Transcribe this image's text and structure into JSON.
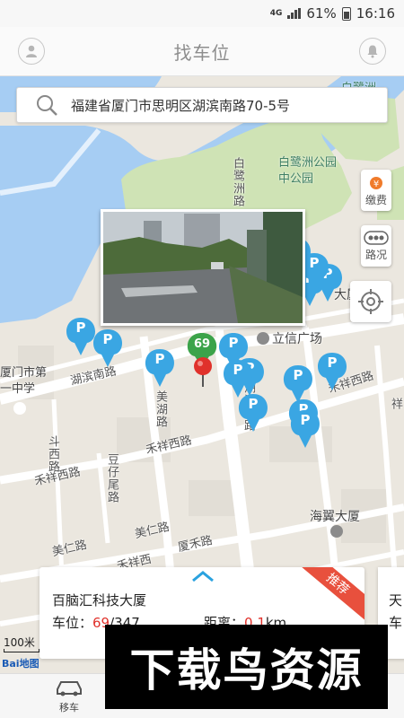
{
  "status_bar": {
    "network": "4G",
    "battery": "61%",
    "time": "16:16"
  },
  "header": {
    "title": "找车位",
    "left_icon": "user-icon",
    "right_icon": "bell-icon"
  },
  "search": {
    "address": "福建省厦门市思明区湖滨南路70-5号",
    "icon": "search-icon"
  },
  "side_buttons": [
    {
      "label": "缴费",
      "icon": "money-bag-icon"
    },
    {
      "label": "路况",
      "icon": "traffic-icon"
    }
  ],
  "map": {
    "streets": {
      "hubin_nanlu": "湖滨南路",
      "hubin_nanlu_2": "湖滨南路",
      "meihu_lu": "美湖路",
      "hexiang_xilu": "禾祥西路",
      "hexiang_xilu_2": "禾祥西路",
      "hexiang_xilu_3": "禾祥西路",
      "doxi_lu": "斗西路",
      "douxi_lu_2": "斗西路",
      "yuzhai_lu": "豆仔尾路",
      "meiren_lu": "美仁路",
      "meiren_lu_2": "美仁路",
      "xiahe_lu": "厦禾路",
      "hexiang_xi": "禾祥西",
      "bailuzhou_lu": "白鹭洲路",
      "hu_fragment": "湖",
      "xiang_fragment": "祥",
      "hubin_left": "湖"
    },
    "pois": {
      "bailuzhou_park": "白鹭洲公园中公园",
      "lixin_plaza": "立信广场",
      "haiyi_dasha": "海翼大厦",
      "school": "厦门市第一中学",
      "dasha_right": "大厦",
      "top_right": "白鹭洲"
    },
    "selected_pin_count": "69",
    "pin_label": "P"
  },
  "controls": {
    "scale": "100米",
    "logo": "Bai地图"
  },
  "card": {
    "name": "百脑汇科技大厦",
    "spots_prefix": "车位：",
    "spots_available": "69",
    "spots_total": "/347",
    "distance_prefix": "距离：",
    "distance_value": "0.1",
    "distance_unit": "km",
    "ribbon": "推荐"
  },
  "card_next": {
    "name_fragment": "天",
    "spots_fragment": "车"
  },
  "tabbar": {
    "tab_label": "移车",
    "tab_icon": "car-icon"
  },
  "watermark": {
    "text": "下载鸟资源"
  },
  "colors": {
    "pin": "#3aa6e3",
    "selected_pin": "#3ca34a",
    "red_marker": "#e0312b",
    "water": "#a6cdf3",
    "park": "#cfe3b5"
  }
}
